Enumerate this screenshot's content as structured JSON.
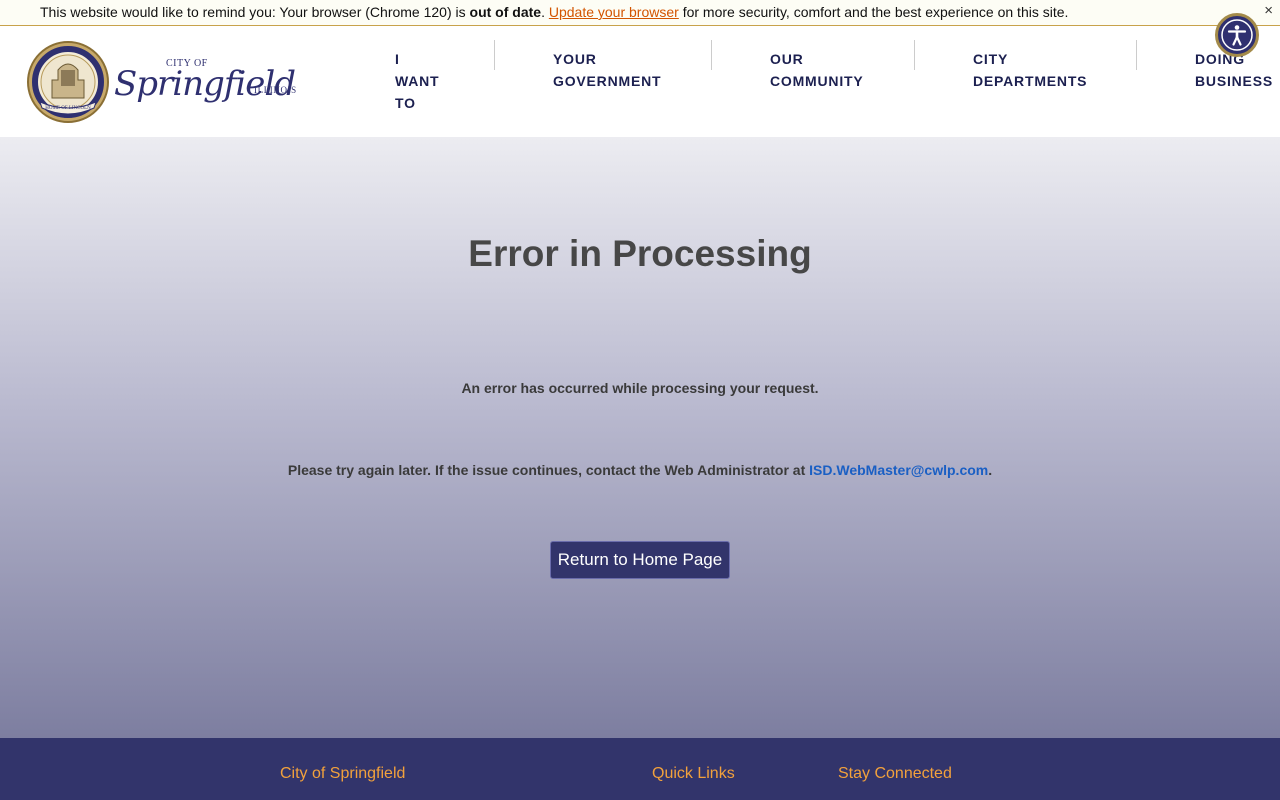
{
  "notice": {
    "text_before": "This website would like to remind you: Your browser (Chrome 120) is ",
    "bold_text": "out of date",
    "text_after_bold": ". ",
    "link_text": "Update your browser",
    "text_end": " for more security, comfort and the best experience on this site.",
    "close_symbol": "×"
  },
  "logo": {
    "city_of": "CITY OF",
    "name": "Springfield",
    "state": "ILLINOIS",
    "seal_top": "CITY OF SPRINGFIELD · CAPITAL OF ILLINOIS",
    "seal_banner": "HOME OF LINCOLN",
    "seal_year": "1840"
  },
  "nav": {
    "items": [
      {
        "lines": [
          "I",
          "WANT",
          "TO"
        ]
      },
      {
        "lines": [
          "YOUR",
          "GOVERNMENT"
        ]
      },
      {
        "lines": [
          "OUR",
          "COMMUNITY"
        ]
      },
      {
        "lines": [
          "CITY",
          "DEPARTMENTS"
        ]
      },
      {
        "lines": [
          "DOING",
          "BUSINESS"
        ]
      }
    ]
  },
  "accessibility": {
    "icon": "accessibility-person-icon"
  },
  "main": {
    "title": "Error in Processing",
    "message": "An error has occurred while processing your request.",
    "help_text": "Please try again later. If the issue continues, contact the Web Administrator at ",
    "help_email": "ISD.WebMaster@cwlp.com",
    "help_end": ".",
    "home_button": "Return to Home Page"
  },
  "footer": {
    "headings": [
      "City of Springfield",
      "Quick Links",
      "Stay Connected"
    ]
  },
  "colors": {
    "brand_navy": "#32346b",
    "accent_gold": "#a48b4a",
    "footer_heading": "#f2a13c",
    "link_blue": "#1a5fc4",
    "notice_link": "#d35400"
  }
}
